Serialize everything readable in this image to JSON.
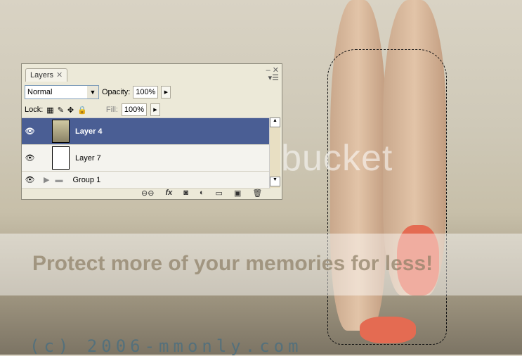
{
  "panel": {
    "tab": "Layers",
    "blend_mode": "Normal",
    "opacity_label": "Opacity:",
    "opacity": "100%",
    "lock_label": "Lock:",
    "fill_label": "Fill:",
    "fill": "100%",
    "layers": [
      {
        "name": "Layer 4",
        "selected": true,
        "visible": true
      },
      {
        "name": "Layer 7",
        "selected": false,
        "visible": true
      },
      {
        "name": "Group 1",
        "selected": false,
        "visible": true,
        "type": "group"
      }
    ]
  },
  "watermark": {
    "brand": "photobucket",
    "banner": "Protect more of your memories for less!",
    "copyright": "(c) 2006-mmonly.com"
  }
}
